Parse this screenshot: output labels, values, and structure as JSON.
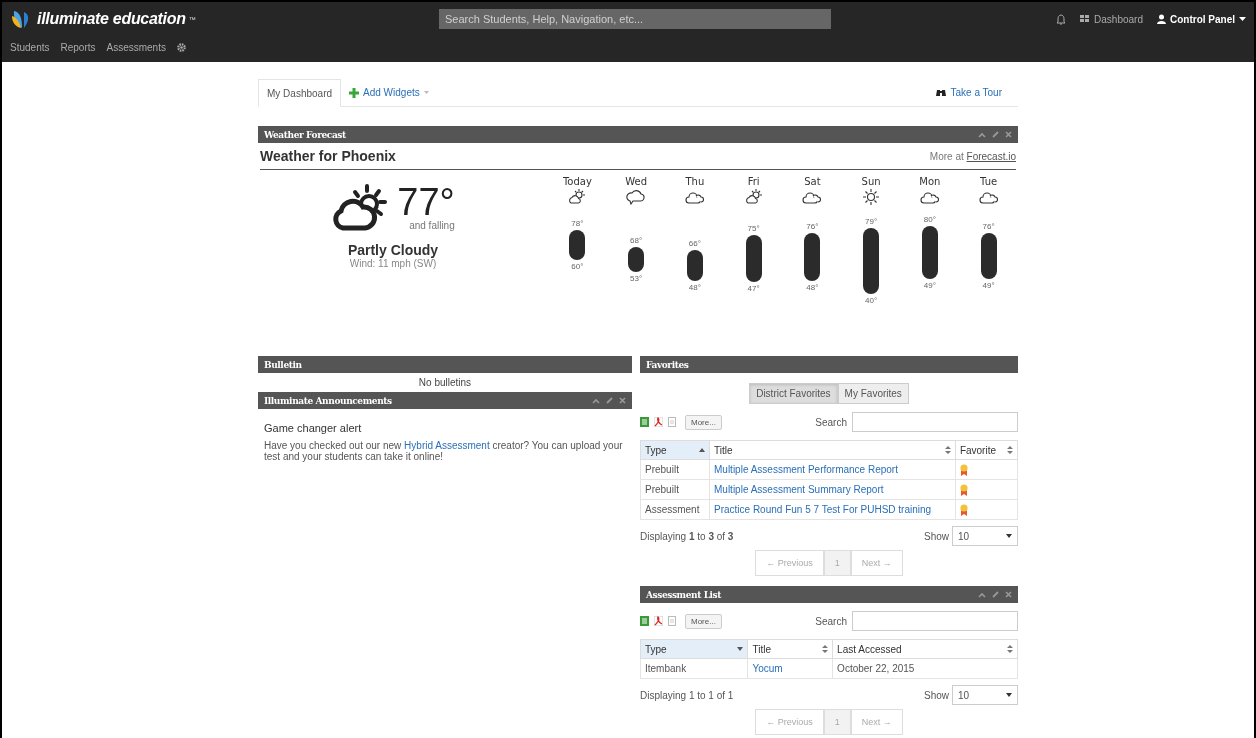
{
  "brand": {
    "name": "illuminate education",
    "mark": "™"
  },
  "search": {
    "placeholder": "Search Students, Help, Navigation, etc..."
  },
  "top_links": {
    "dashboard": "Dashboard",
    "control_panel": "Control Panel"
  },
  "nav": [
    "Students",
    "Reports",
    "Assessments"
  ],
  "tabs": [
    {
      "label": "My Dashboard",
      "kind": "tab",
      "selected": true
    },
    {
      "label": "Add Widgets",
      "kind": "add",
      "selected": false
    }
  ],
  "tour": "Take a Tour",
  "weather": {
    "header": "Weather Forecast",
    "controls": true,
    "title": "Weather for Phoenix",
    "more_prefix": "More at",
    "more_link": "Forecast.io",
    "current": {
      "temp": "77°",
      "trend": "and falling",
      "summary": "Partly Cloudy",
      "wind": "Wind: 11 mph (SW)"
    },
    "days": [
      {
        "day": "Today",
        "kind": "partly-cloudy",
        "high": "78°",
        "low": "60°"
      },
      {
        "day": "Wed",
        "kind": "overcast",
        "high": "68°",
        "low": "53°"
      },
      {
        "day": "Thu",
        "kind": "cloudy",
        "high": "66°",
        "low": "48°"
      },
      {
        "day": "Fri",
        "kind": "partly-cloudy",
        "high": "75°",
        "low": "47°"
      },
      {
        "day": "Sat",
        "kind": "cloudy",
        "high": "76°",
        "low": "48°"
      },
      {
        "day": "Sun",
        "kind": "clear",
        "high": "79°",
        "low": "40°"
      },
      {
        "day": "Mon",
        "kind": "cloudy",
        "high": "80°",
        "low": "49°"
      },
      {
        "day": "Tue",
        "kind": "cloudy",
        "high": "76°",
        "low": "49°"
      }
    ]
  },
  "bulletin": {
    "header": "Bulletin",
    "controls": false,
    "empty": "No bulletins"
  },
  "announcements": {
    "header": "Illuminate Announcements",
    "controls": true,
    "title": "Game changer alert",
    "before": "Have you checked out our new ",
    "link": "Hybrid Assessment",
    "after": " creator? You can upload your test and your students can take it online!"
  },
  "favorites": {
    "header": "Favorites",
    "controls": false,
    "toggles": [
      {
        "label": "District Favorites",
        "selected": true
      },
      {
        "label": "My Favorites",
        "selected": false
      }
    ],
    "more": "More...",
    "search_label": "Search",
    "columns": [
      {
        "label": "Type",
        "kind": "asc"
      },
      {
        "label": "Title",
        "kind": "both"
      },
      {
        "label": "Favorite",
        "kind": "both"
      }
    ],
    "rows": [
      {
        "type": "Prebuilt",
        "title": "Multiple Assessment Performance Report",
        "favorite": true
      },
      {
        "type": "Prebuilt",
        "title": "Multiple Assessment Summary Report",
        "favorite": true
      },
      {
        "type": "Assessment",
        "title": "Practice Round Fun 5 7 Test For PUHSD training",
        "favorite": true
      }
    ],
    "summary": "Displaying **1** to **3** of **3**",
    "show_label": "Show",
    "show_value": "10",
    "pager": {
      "previous": "← Previous",
      "page": "1",
      "next": "Next →"
    }
  },
  "assessment_list": {
    "header": "Assessment List",
    "controls": true,
    "more": "More...",
    "search_label": "Search",
    "columns": [
      {
        "label": "Type",
        "kind": "desc"
      },
      {
        "label": "Title",
        "kind": "both"
      },
      {
        "label": "Last Accessed",
        "kind": "both"
      }
    ],
    "rows": [
      {
        "type": "Itembank",
        "title": "Yocum",
        "last_accessed": "October 22, 2015"
      }
    ],
    "summary": "Displaying 1 to 1 of 1",
    "show_label": "Show",
    "show_value": "10",
    "pager": {
      "previous": "← Previous",
      "page": "1",
      "next": "Next →"
    }
  }
}
